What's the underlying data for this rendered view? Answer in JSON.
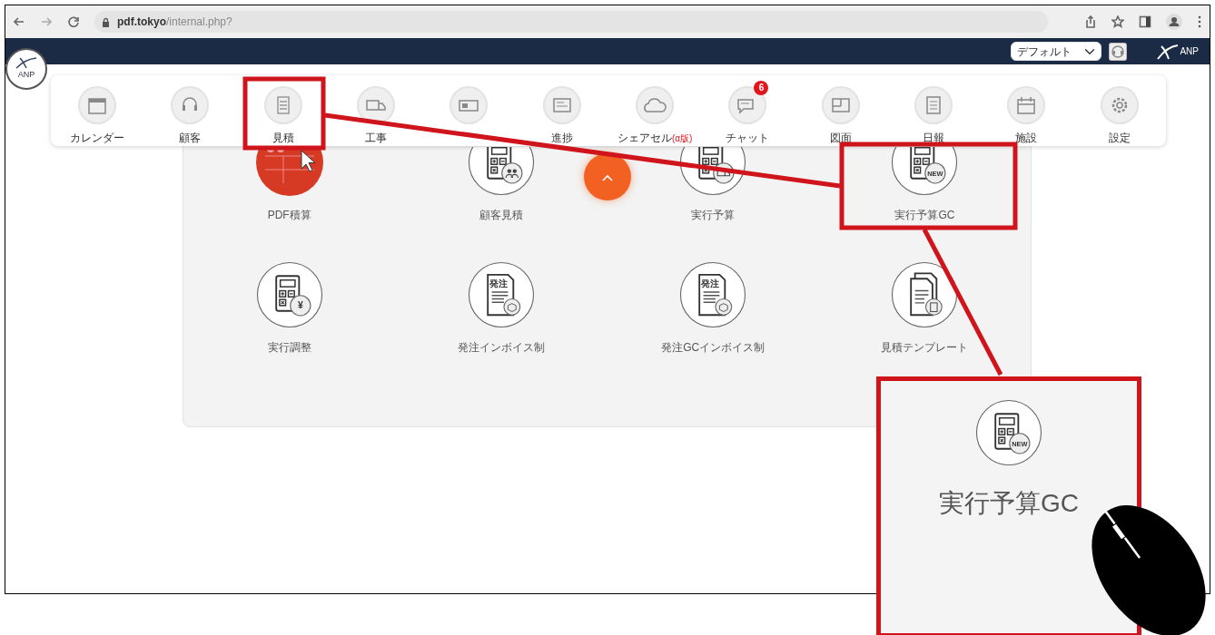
{
  "browser": {
    "url": "**pdf.tokyo**/internal.php?"
  },
  "header": {
    "logo_text": "ANP",
    "theme_select": {
      "value": "デフォルト"
    },
    "brand_text": "ANP"
  },
  "nav_items": [
    {
      "label": "カレンダー"
    },
    {
      "label": "顧客"
    },
    {
      "label": "見積"
    },
    {
      "label": "工事"
    },
    {
      "kind": "icon_only"
    },
    {
      "label": "進捗"
    },
    {
      "label": "シェアセル",
      "tag": "(α版)"
    },
    {
      "label": "チャット",
      "badge": "6"
    },
    {
      "label": "図面"
    },
    {
      "label": "日報"
    },
    {
      "label": "施設"
    },
    {
      "label": "設定"
    }
  ],
  "tiles": [
    {
      "label": "PDF積算",
      "kind": "thumbnail"
    },
    {
      "label": "顧客見積",
      "kind": "calculator"
    },
    {
      "label": "実行予算",
      "kind": "calculator"
    },
    {
      "label": "実行予算GC",
      "kind": "calculator",
      "badge": "NEW"
    },
    {
      "label": "実行調整",
      "kind": "calculator",
      "badge": "¥"
    },
    {
      "label": "発注インボイス制",
      "kind": "order",
      "heading": "発注"
    },
    {
      "label": "発注GCインボイス制",
      "kind": "order",
      "heading": "発注"
    },
    {
      "label": "見積テンプレート",
      "kind": "template"
    }
  ],
  "zoom_inset": {
    "label": "実行予算GC",
    "badge": "NEW"
  }
}
